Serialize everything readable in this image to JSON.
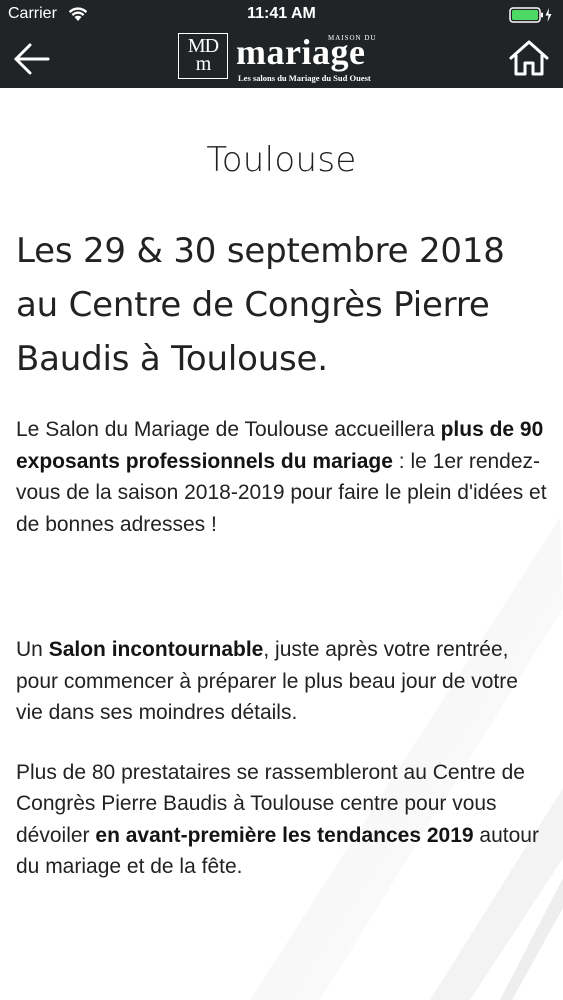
{
  "status_bar": {
    "carrier": "Carrier",
    "time": "11:41 AM"
  },
  "nav": {
    "logo": {
      "mark_top": "MD",
      "mark_bottom": "m",
      "small_text": "MAISON DU",
      "word": "mariage",
      "tagline": "Les salons du Mariage du Sud Ouest"
    },
    "back_icon": "arrow-left-icon",
    "home_icon": "home-icon"
  },
  "page": {
    "title": "Toulouse",
    "headline": "Les 29 & 30 septembre 2018 au Centre de Congrès Pierre Baudis à Toulouse.",
    "p1": {
      "t1": "Le Salon du Mariage de Toulouse accueillera ",
      "b1": "plus de 90 exposants professionnels du mariage",
      "t2": " : le 1er rendez-vous de la saison 2018-2019 pour faire le plein d'idées et de bonnes adresses !"
    },
    "p2": {
      "t1": "Un ",
      "b1": "Salon incontournable",
      "t2": ", juste après votre rentrée, pour commencer à préparer le plus beau jour de votre vie dans ses moindres détails."
    },
    "p3": {
      "t1": "Plus de 80 prestataires se rassembleront au Centre de Congrès Pierre Baudis à Toulouse centre pour vous dévoiler ",
      "b1": "en avant-première les tendances 2019",
      "t2": " autour du mariage et de la fête."
    }
  },
  "colors": {
    "bar_background": "#212427",
    "text": "#222222",
    "page_background": "#ffffff"
  }
}
